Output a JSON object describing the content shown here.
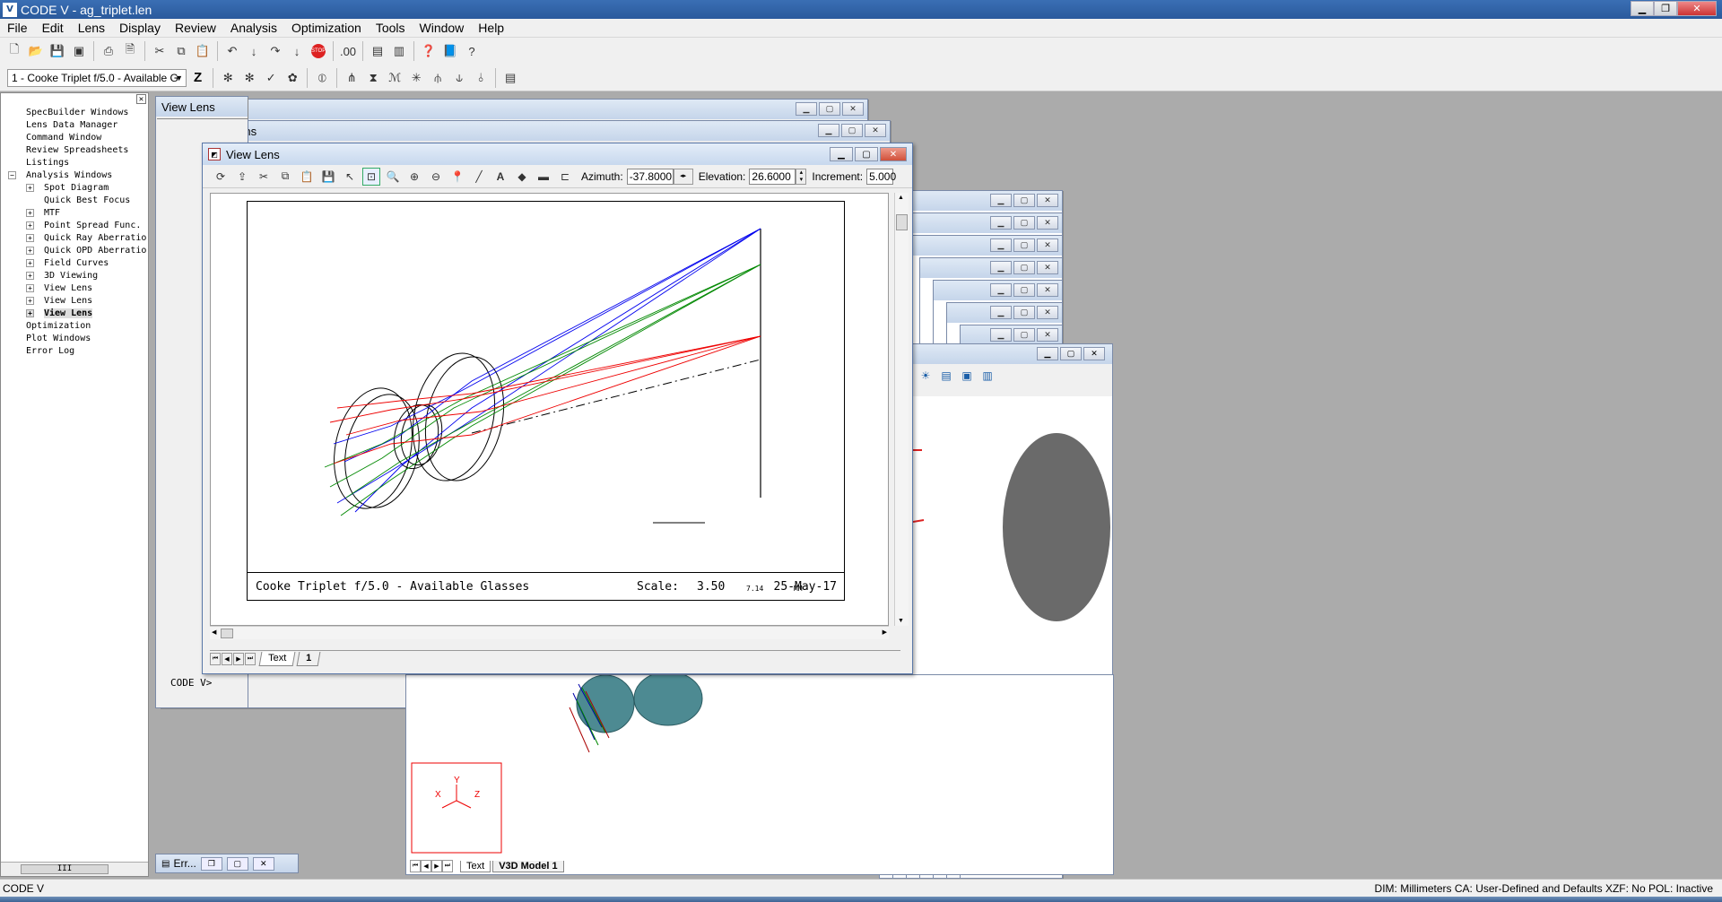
{
  "app": {
    "title": "CODE V - ag_triplet.len",
    "icon_label": "V"
  },
  "menu": [
    "File",
    "Edit",
    "Lens",
    "Display",
    "Review",
    "Analysis",
    "Optimization",
    "Tools",
    "Window",
    "Help"
  ],
  "toolbar2": {
    "lens_select_value": "1 - Cooke Triplet f/5.0 - Available G",
    "z_label": "Z"
  },
  "tree": {
    "items": [
      {
        "label": "SpecBuilder Windows",
        "level": 0,
        "expander": ""
      },
      {
        "label": "Lens Data Manager",
        "level": 0,
        "expander": ""
      },
      {
        "label": "Command Window",
        "level": 0,
        "expander": ""
      },
      {
        "label": "Review Spreadsheets",
        "level": 0,
        "expander": ""
      },
      {
        "label": "Listings",
        "level": 0,
        "expander": ""
      },
      {
        "label": "Analysis Windows",
        "level": 0,
        "expander": "−"
      },
      {
        "label": "Spot Diagram",
        "level": 1,
        "expander": "+"
      },
      {
        "label": "Quick Best Focus",
        "level": 1,
        "expander": ""
      },
      {
        "label": "MTF",
        "level": 1,
        "expander": "+"
      },
      {
        "label": "Point Spread Func.",
        "level": 1,
        "expander": "+"
      },
      {
        "label": "Quick Ray Aberratio",
        "level": 1,
        "expander": "+"
      },
      {
        "label": "Quick OPD Aberratio",
        "level": 1,
        "expander": "+"
      },
      {
        "label": "Field Curves",
        "level": 1,
        "expander": "+"
      },
      {
        "label": "3D Viewing",
        "level": 1,
        "expander": "+"
      },
      {
        "label": "View Lens",
        "level": 1,
        "expander": "+"
      },
      {
        "label": "View Lens",
        "level": 1,
        "expander": "+"
      },
      {
        "label": "View Lens",
        "level": 1,
        "expander": "+",
        "bold": true
      },
      {
        "label": "Optimization",
        "level": 0,
        "expander": ""
      },
      {
        "label": "Plot Windows",
        "level": 0,
        "expander": ""
      },
      {
        "label": "Error Log",
        "level": 0,
        "expander": ""
      }
    ],
    "scroll_thumb_label": "III"
  },
  "bg_windows": {
    "title": "View Lens"
  },
  "main_window": {
    "title": "View Lens",
    "azimuth_label": "Azimuth:",
    "azimuth_value": "-37.8000",
    "elevation_label": "Elevation:",
    "elevation_value": "26.6000",
    "increment_label": "Increment:",
    "increment_value": "5.000",
    "tabs": [
      "Text",
      "1"
    ],
    "active_tab": "1"
  },
  "plot": {
    "caption_title": "Cooke Triplet f/5.0 - Available Glasses",
    "scale_label": "Scale:",
    "scale_value": "3.50",
    "date": "25-May-17",
    "scale_bar_value": "7.14",
    "scale_bar_unit": "MM",
    "ray_colors": {
      "field1": "#0000ee",
      "field2": "#008800",
      "field3": "#ee0000"
    }
  },
  "v3d_window": {
    "tabs": [
      "Text",
      "V3D Model 1"
    ],
    "active_tab": "V3D Model 1",
    "axis_labels": {
      "x": "X",
      "y": "Y",
      "z": "Z"
    }
  },
  "command_window": {
    "prompt": "CODE V>",
    "partial_number": "25"
  },
  "error_window": {
    "title": "Err..."
  },
  "status": {
    "left": "CODE V",
    "right": "DIM: Millimeters CA: User-Defined and Defaults XZF: No    POL: Inactive"
  }
}
